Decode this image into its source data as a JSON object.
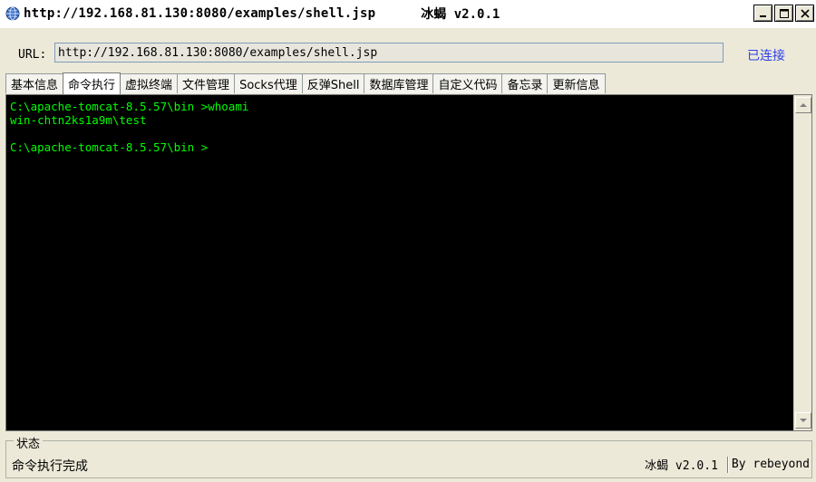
{
  "window": {
    "title_url": "http://192.168.81.130:8080/examples/shell.jsp",
    "title_app": "冰蝎 v2.0.1",
    "minimize": "_",
    "maximize": "□",
    "close": "X"
  },
  "urlbar": {
    "label": "URL:",
    "value": "http://192.168.81.130:8080/examples/shell.jsp",
    "status": "已连接",
    "status_color": "#2c3eea"
  },
  "tabs": [
    {
      "label": "基本信息",
      "active": false
    },
    {
      "label": "命令执行",
      "active": true
    },
    {
      "label": "虚拟终端",
      "active": false
    },
    {
      "label": "文件管理",
      "active": false
    },
    {
      "label": "Socks代理",
      "active": false
    },
    {
      "label": "反弹Shell",
      "active": false
    },
    {
      "label": "数据库管理",
      "active": false
    },
    {
      "label": "自定义代码",
      "active": false
    },
    {
      "label": "备忘录",
      "active": false
    },
    {
      "label": "更新信息",
      "active": false
    }
  ],
  "terminal": {
    "lines": [
      "C:\\apache-tomcat-8.5.57\\bin >whoami",
      "win-chtn2ks1a9m\\test",
      "",
      "C:\\apache-tomcat-8.5.57\\bin >"
    ],
    "text_color": "#00ff00",
    "bg_color": "#000000"
  },
  "status": {
    "legend": "状态",
    "message": "命令执行完成",
    "version": "冰蝎 v2.0.1",
    "author": "By rebeyond"
  }
}
